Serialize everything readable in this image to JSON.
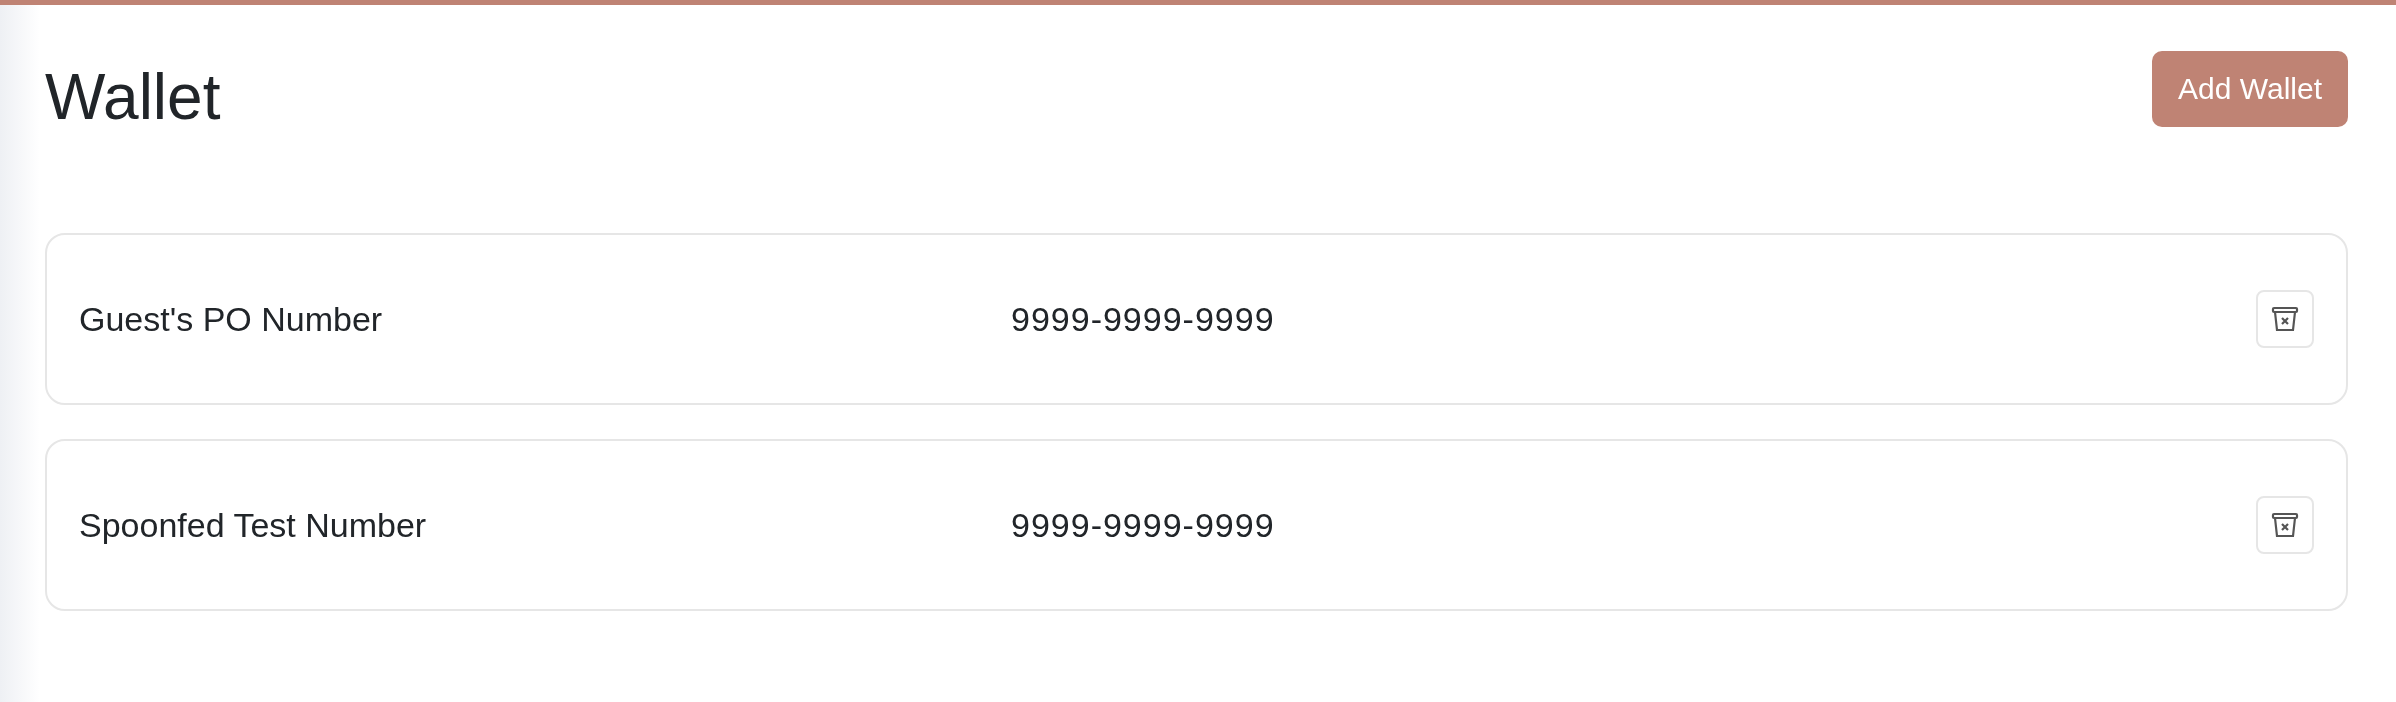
{
  "page": {
    "title": "Wallet",
    "action": "Add Wallet"
  },
  "wallets": [
    {
      "name": "Guest's PO Number",
      "number": "9999-9999-9999"
    },
    {
      "name": "Spoonfed Test Number",
      "number": "9999-9999-9999"
    }
  ]
}
